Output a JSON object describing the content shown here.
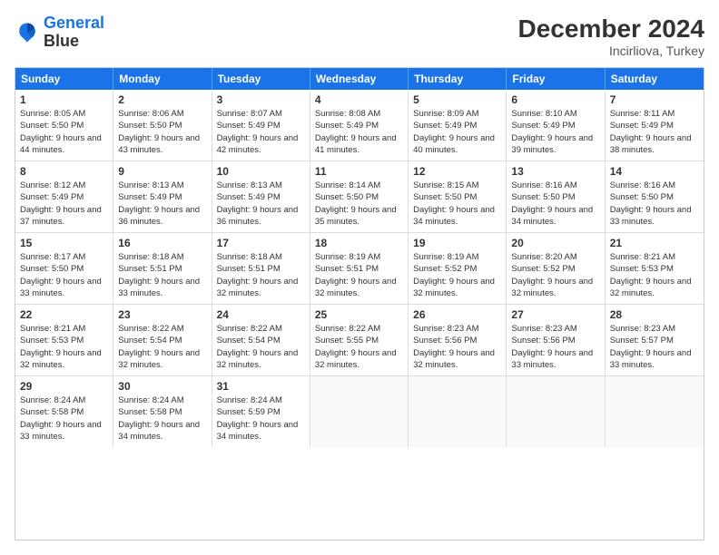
{
  "logo": {
    "line1": "General",
    "line2": "Blue"
  },
  "title": "December 2024",
  "subtitle": "Incirliova, Turkey",
  "headers": [
    "Sunday",
    "Monday",
    "Tuesday",
    "Wednesday",
    "Thursday",
    "Friday",
    "Saturday"
  ],
  "rows": [
    [
      {
        "day": "1",
        "sunrise": "Sunrise: 8:05 AM",
        "sunset": "Sunset: 5:50 PM",
        "daylight": "Daylight: 9 hours and 44 minutes."
      },
      {
        "day": "2",
        "sunrise": "Sunrise: 8:06 AM",
        "sunset": "Sunset: 5:50 PM",
        "daylight": "Daylight: 9 hours and 43 minutes."
      },
      {
        "day": "3",
        "sunrise": "Sunrise: 8:07 AM",
        "sunset": "Sunset: 5:49 PM",
        "daylight": "Daylight: 9 hours and 42 minutes."
      },
      {
        "day": "4",
        "sunrise": "Sunrise: 8:08 AM",
        "sunset": "Sunset: 5:49 PM",
        "daylight": "Daylight: 9 hours and 41 minutes."
      },
      {
        "day": "5",
        "sunrise": "Sunrise: 8:09 AM",
        "sunset": "Sunset: 5:49 PM",
        "daylight": "Daylight: 9 hours and 40 minutes."
      },
      {
        "day": "6",
        "sunrise": "Sunrise: 8:10 AM",
        "sunset": "Sunset: 5:49 PM",
        "daylight": "Daylight: 9 hours and 39 minutes."
      },
      {
        "day": "7",
        "sunrise": "Sunrise: 8:11 AM",
        "sunset": "Sunset: 5:49 PM",
        "daylight": "Daylight: 9 hours and 38 minutes."
      }
    ],
    [
      {
        "day": "8",
        "sunrise": "Sunrise: 8:12 AM",
        "sunset": "Sunset: 5:49 PM",
        "daylight": "Daylight: 9 hours and 37 minutes."
      },
      {
        "day": "9",
        "sunrise": "Sunrise: 8:13 AM",
        "sunset": "Sunset: 5:49 PM",
        "daylight": "Daylight: 9 hours and 36 minutes."
      },
      {
        "day": "10",
        "sunrise": "Sunrise: 8:13 AM",
        "sunset": "Sunset: 5:49 PM",
        "daylight": "Daylight: 9 hours and 36 minutes."
      },
      {
        "day": "11",
        "sunrise": "Sunrise: 8:14 AM",
        "sunset": "Sunset: 5:50 PM",
        "daylight": "Daylight: 9 hours and 35 minutes."
      },
      {
        "day": "12",
        "sunrise": "Sunrise: 8:15 AM",
        "sunset": "Sunset: 5:50 PM",
        "daylight": "Daylight: 9 hours and 34 minutes."
      },
      {
        "day": "13",
        "sunrise": "Sunrise: 8:16 AM",
        "sunset": "Sunset: 5:50 PM",
        "daylight": "Daylight: 9 hours and 34 minutes."
      },
      {
        "day": "14",
        "sunrise": "Sunrise: 8:16 AM",
        "sunset": "Sunset: 5:50 PM",
        "daylight": "Daylight: 9 hours and 33 minutes."
      }
    ],
    [
      {
        "day": "15",
        "sunrise": "Sunrise: 8:17 AM",
        "sunset": "Sunset: 5:50 PM",
        "daylight": "Daylight: 9 hours and 33 minutes."
      },
      {
        "day": "16",
        "sunrise": "Sunrise: 8:18 AM",
        "sunset": "Sunset: 5:51 PM",
        "daylight": "Daylight: 9 hours and 33 minutes."
      },
      {
        "day": "17",
        "sunrise": "Sunrise: 8:18 AM",
        "sunset": "Sunset: 5:51 PM",
        "daylight": "Daylight: 9 hours and 32 minutes."
      },
      {
        "day": "18",
        "sunrise": "Sunrise: 8:19 AM",
        "sunset": "Sunset: 5:51 PM",
        "daylight": "Daylight: 9 hours and 32 minutes."
      },
      {
        "day": "19",
        "sunrise": "Sunrise: 8:19 AM",
        "sunset": "Sunset: 5:52 PM",
        "daylight": "Daylight: 9 hours and 32 minutes."
      },
      {
        "day": "20",
        "sunrise": "Sunrise: 8:20 AM",
        "sunset": "Sunset: 5:52 PM",
        "daylight": "Daylight: 9 hours and 32 minutes."
      },
      {
        "day": "21",
        "sunrise": "Sunrise: 8:21 AM",
        "sunset": "Sunset: 5:53 PM",
        "daylight": "Daylight: 9 hours and 32 minutes."
      }
    ],
    [
      {
        "day": "22",
        "sunrise": "Sunrise: 8:21 AM",
        "sunset": "Sunset: 5:53 PM",
        "daylight": "Daylight: 9 hours and 32 minutes."
      },
      {
        "day": "23",
        "sunrise": "Sunrise: 8:22 AM",
        "sunset": "Sunset: 5:54 PM",
        "daylight": "Daylight: 9 hours and 32 minutes."
      },
      {
        "day": "24",
        "sunrise": "Sunrise: 8:22 AM",
        "sunset": "Sunset: 5:54 PM",
        "daylight": "Daylight: 9 hours and 32 minutes."
      },
      {
        "day": "25",
        "sunrise": "Sunrise: 8:22 AM",
        "sunset": "Sunset: 5:55 PM",
        "daylight": "Daylight: 9 hours and 32 minutes."
      },
      {
        "day": "26",
        "sunrise": "Sunrise: 8:23 AM",
        "sunset": "Sunset: 5:56 PM",
        "daylight": "Daylight: 9 hours and 32 minutes."
      },
      {
        "day": "27",
        "sunrise": "Sunrise: 8:23 AM",
        "sunset": "Sunset: 5:56 PM",
        "daylight": "Daylight: 9 hours and 33 minutes."
      },
      {
        "day": "28",
        "sunrise": "Sunrise: 8:23 AM",
        "sunset": "Sunset: 5:57 PM",
        "daylight": "Daylight: 9 hours and 33 minutes."
      }
    ],
    [
      {
        "day": "29",
        "sunrise": "Sunrise: 8:24 AM",
        "sunset": "Sunset: 5:58 PM",
        "daylight": "Daylight: 9 hours and 33 minutes."
      },
      {
        "day": "30",
        "sunrise": "Sunrise: 8:24 AM",
        "sunset": "Sunset: 5:58 PM",
        "daylight": "Daylight: 9 hours and 34 minutes."
      },
      {
        "day": "31",
        "sunrise": "Sunrise: 8:24 AM",
        "sunset": "Sunset: 5:59 PM",
        "daylight": "Daylight: 9 hours and 34 minutes."
      },
      null,
      null,
      null,
      null
    ]
  ]
}
